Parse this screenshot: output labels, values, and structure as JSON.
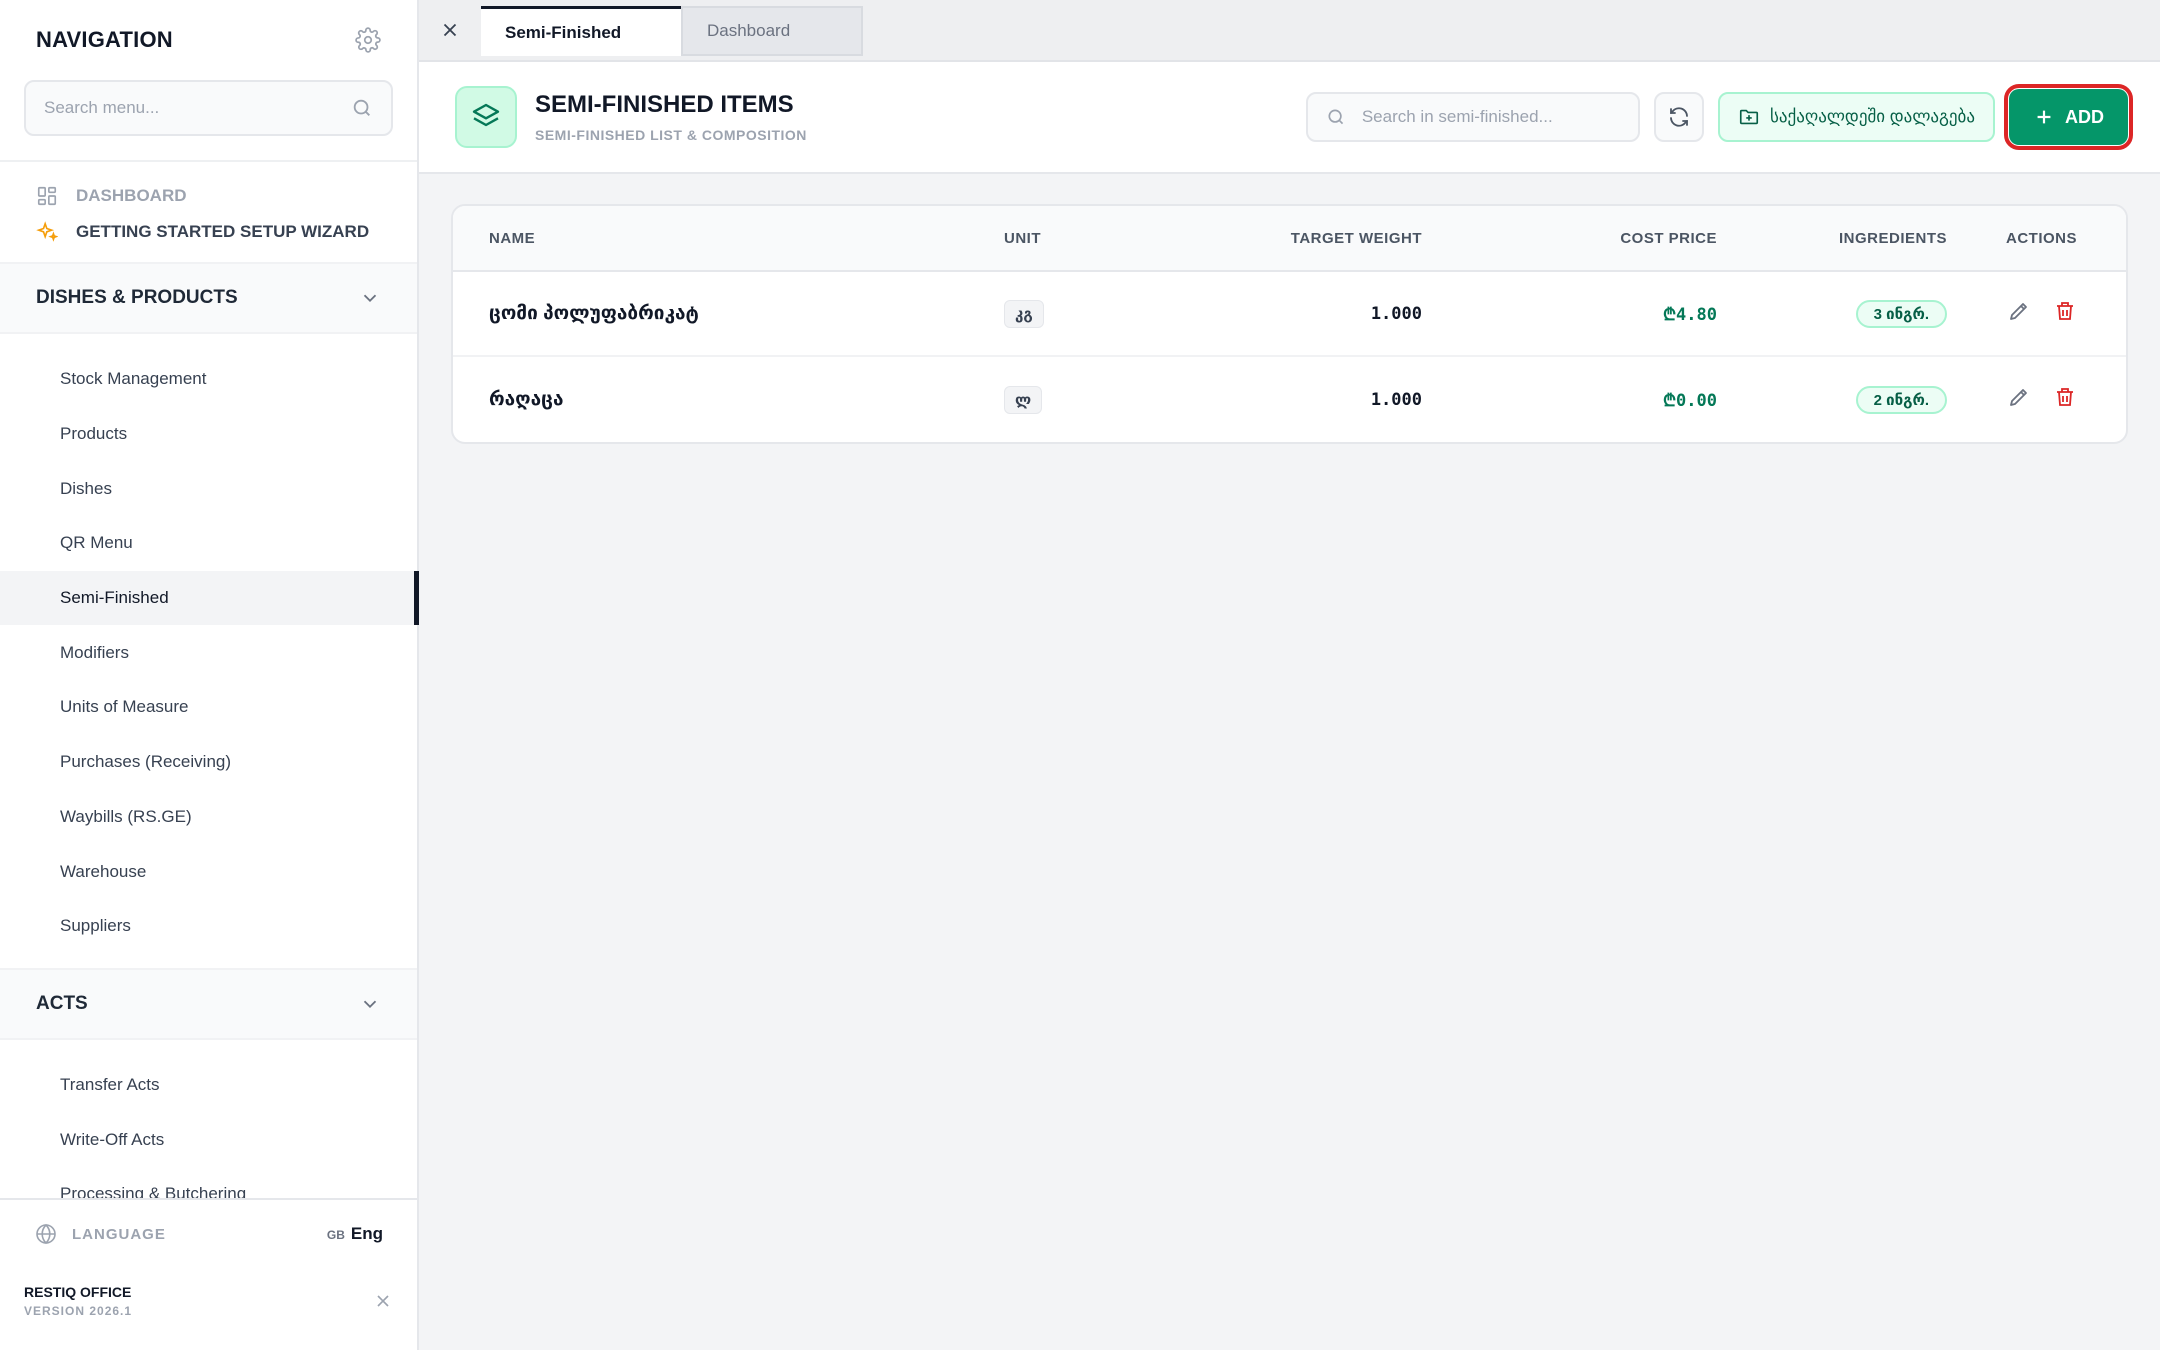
{
  "sidebar": {
    "title": "NAVIGATION",
    "search_placeholder": "Search menu...",
    "top_links": [
      {
        "label": "DASHBOARD",
        "icon": "grid-icon"
      },
      {
        "label": "GETTING STARTED SETUP WIZARD",
        "icon": "sparkles-icon"
      }
    ],
    "sections": [
      {
        "label": "DISHES & PRODUCTS",
        "expanded": true,
        "items": [
          "Stock Management",
          "Products",
          "Dishes",
          "QR Menu",
          "Semi-Finished",
          "Modifiers",
          "Units of Measure",
          "Purchases (Receiving)",
          "Waybills (RS.GE)",
          "Warehouse",
          "Suppliers"
        ],
        "active_item": "Semi-Finished"
      },
      {
        "label": "ACTS",
        "expanded": true,
        "items": [
          "Transfer Acts",
          "Write-Off Acts",
          "Processing & Butchering"
        ]
      }
    ],
    "footer": {
      "language_label": "LANGUAGE",
      "language_flag": "GB",
      "language_value": "Eng",
      "app_name": "RESTIQ OFFICE",
      "version": "VERSION 2026.1"
    }
  },
  "tabs": [
    {
      "label": "Semi-Finished",
      "active": true
    },
    {
      "label": "Dashboard",
      "active": false
    }
  ],
  "header": {
    "title": "SEMI-FINISHED ITEMS",
    "subtitle": "SEMI-FINISHED LIST & COMPOSITION",
    "search_placeholder": "Search in semi-finished...",
    "folder_button_label": "საქაღალდეში დალაგება",
    "add_button_label": "ADD"
  },
  "table": {
    "columns": [
      "NAME",
      "UNIT",
      "TARGET WEIGHT",
      "COST PRICE",
      "INGREDIENTS",
      "ACTIONS"
    ],
    "rows": [
      {
        "name": "ცომი პოლუფაბრიკატ",
        "unit": "კგ",
        "target_weight": "1.000",
        "cost_price": "₾4.80",
        "ingredients": "3 ინგრ."
      },
      {
        "name": "რაღაცა",
        "unit": "ლ",
        "target_weight": "1.000",
        "cost_price": "₾0.00",
        "ingredients": "2 ინგრ."
      }
    ]
  },
  "colors": {
    "accent": "#059669",
    "accent_light": "#ecfdf5",
    "danger": "#dc2626",
    "active_indicator": "#111827"
  }
}
